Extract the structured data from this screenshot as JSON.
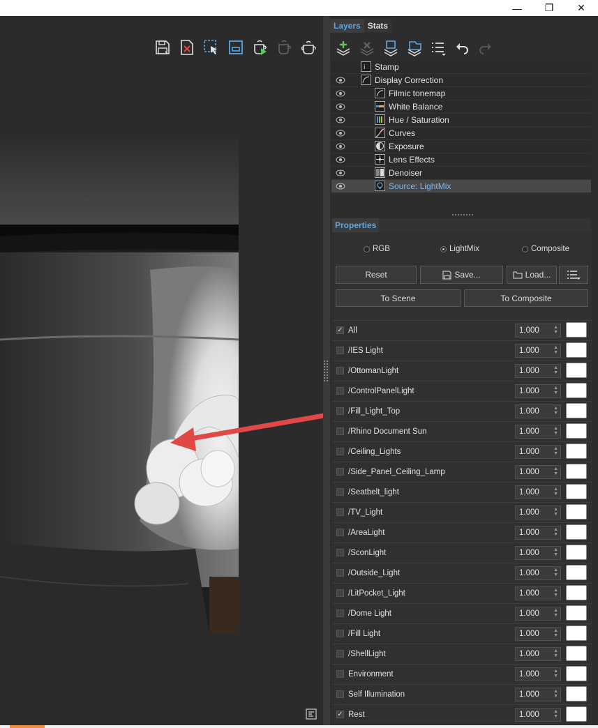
{
  "window": {
    "minimize_icon": "minimize-icon",
    "maximize_icon": "restore-icon",
    "close_icon": "close-icon",
    "minimize_glyph": "—",
    "maximize_glyph": "❐",
    "close_glyph": "✕"
  },
  "viewport_toolbar": {
    "icons": [
      "save-image-icon",
      "clear-image-icon",
      "select-region-icon",
      "region-render-icon",
      "start-render-icon",
      "stop-render-icon",
      "render-teapot-icon"
    ]
  },
  "tabs": {
    "layers": "Layers",
    "stats": "Stats"
  },
  "layer_toolbar": {
    "icons": [
      "add-layer-icon",
      "delete-layer-icon",
      "load-layers-icon",
      "save-layers-icon",
      "layer-menu-icon",
      "undo-icon",
      "redo-icon"
    ]
  },
  "layers": [
    {
      "label": "Stamp",
      "indent": 1,
      "eye": false,
      "selected": false
    },
    {
      "label": "Display Correction",
      "indent": 1,
      "eye": true,
      "selected": false
    },
    {
      "label": "Filmic tonemap",
      "indent": 2,
      "eye": true,
      "selected": false
    },
    {
      "label": "White Balance",
      "indent": 2,
      "eye": true,
      "selected": false
    },
    {
      "label": "Hue / Saturation",
      "indent": 2,
      "eye": true,
      "selected": false
    },
    {
      "label": "Curves",
      "indent": 2,
      "eye": true,
      "selected": false
    },
    {
      "label": "Exposure",
      "indent": 2,
      "eye": true,
      "selected": false
    },
    {
      "label": "Lens Effects",
      "indent": 2,
      "eye": true,
      "selected": false
    },
    {
      "label": "Denoiser",
      "indent": 2,
      "eye": true,
      "selected": false
    },
    {
      "label": "Source: LightMix",
      "indent": 2,
      "eye": true,
      "selected": true
    }
  ],
  "properties": {
    "tab": "Properties",
    "radio": {
      "rgb": "RGB",
      "lightmix": "LightMix",
      "composite": "Composite",
      "selected": "LightMix"
    },
    "buttons": {
      "reset": "Reset",
      "save": "Save...",
      "load": "Load...",
      "to_scene": "To Scene",
      "to_composite": "To Composite"
    },
    "lights": [
      {
        "name": "All",
        "value": "1.000",
        "checked": true
      },
      {
        "name": "/IES Light",
        "value": "1.000",
        "checked": false
      },
      {
        "name": "/OttomanLight",
        "value": "1.000",
        "checked": false
      },
      {
        "name": "/ControlPanelLight",
        "value": "1.000",
        "checked": false
      },
      {
        "name": "/Fill_Light_Top",
        "value": "1.000",
        "checked": false
      },
      {
        "name": "/Rhino Document Sun",
        "value": "1.000",
        "checked": false
      },
      {
        "name": "/Ceiling_Lights",
        "value": "1.000",
        "checked": false
      },
      {
        "name": "/Side_Panel_Ceiling_Lamp",
        "value": "1.000",
        "checked": false
      },
      {
        "name": "/Seatbelt_light",
        "value": "1.000",
        "checked": false
      },
      {
        "name": "/TV_Light",
        "value": "1.000",
        "checked": false
      },
      {
        "name": "/AreaLight",
        "value": "1.000",
        "checked": false
      },
      {
        "name": "/SconLight",
        "value": "1.000",
        "checked": false
      },
      {
        "name": "/Outside_Light",
        "value": "1.000",
        "checked": false
      },
      {
        "name": "/LitPocket_Light",
        "value": "1.000",
        "checked": false
      },
      {
        "name": "/Dome Light",
        "value": "1.000",
        "checked": false
      },
      {
        "name": "/Fill Light",
        "value": "1.000",
        "checked": false
      },
      {
        "name": "/ShellLight",
        "value": "1.000",
        "checked": false
      },
      {
        "name": "Environment",
        "value": "1.000",
        "checked": false
      },
      {
        "name": "Self Illumination",
        "value": "1.000",
        "checked": false
      },
      {
        "name": "Rest",
        "value": "1.000",
        "checked": true
      }
    ]
  },
  "colors": {
    "accent": "#5aa7e6",
    "arrow": "#e04848",
    "swatch": "#ffffff"
  }
}
